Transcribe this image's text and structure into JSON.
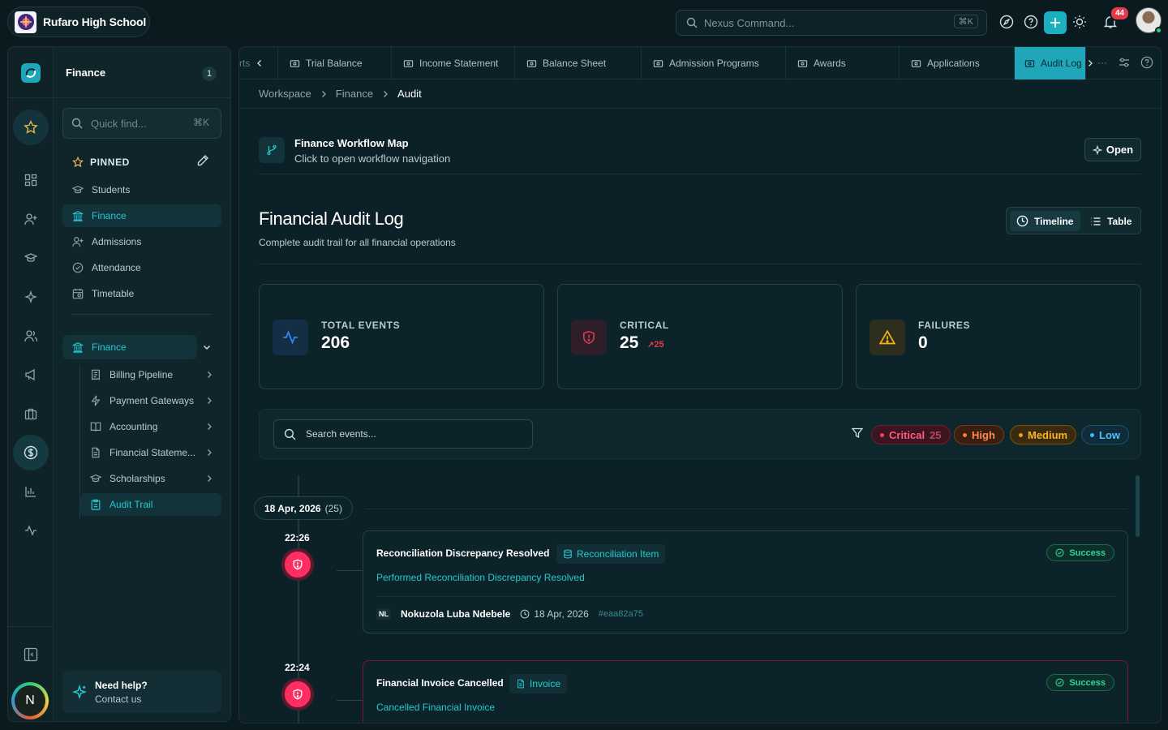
{
  "app": {
    "school_name": "Rufaro High School"
  },
  "topbar": {
    "command_placeholder": "Nexus Command...",
    "command_shortcut": "⌘K",
    "notification_count": "44"
  },
  "sidebar": {
    "title": "Finance",
    "count": "1",
    "quick_find_placeholder": "Quick find...",
    "quick_find_shortcut": "⌘K",
    "pinned_label": "PINNED",
    "pinned_items": [
      {
        "label": "Students",
        "icon": "graduation-cap-icon"
      },
      {
        "label": "Finance",
        "icon": "bank-icon",
        "active": true
      },
      {
        "label": "Admissions",
        "icon": "user-plus-icon"
      },
      {
        "label": "Attendance",
        "icon": "check-circle-icon"
      },
      {
        "label": "Timetable",
        "icon": "calendar-icon"
      }
    ],
    "group_label": "Finance",
    "sub_items": [
      {
        "label": "Billing Pipeline",
        "icon": "receipt-icon"
      },
      {
        "label": "Payment Gateways",
        "icon": "zap-icon"
      },
      {
        "label": "Accounting",
        "icon": "book-icon"
      },
      {
        "label": "Financial Stateme...",
        "icon": "file-text-icon"
      },
      {
        "label": "Scholarships",
        "icon": "graduation-cap-icon"
      },
      {
        "label": "Audit Trail",
        "icon": "clipboard-icon",
        "active": true
      }
    ],
    "help_title": "Need help?",
    "help_sub": "Contact us",
    "user_initial": "N"
  },
  "tabs": {
    "overflow_prefix": "rts",
    "items": [
      {
        "label": "Trial Balance"
      },
      {
        "label": "Income Statement"
      },
      {
        "label": "Balance Sheet"
      },
      {
        "label": "Admission Programs"
      },
      {
        "label": "Awards"
      },
      {
        "label": "Applications"
      },
      {
        "label": "Audit Log",
        "active": true
      }
    ]
  },
  "breadcrumb": [
    "Workspace",
    "Finance",
    "Audit"
  ],
  "workflow": {
    "title": "Finance Workflow Map",
    "subtitle": "Click to open workflow navigation",
    "open_label": "Open"
  },
  "page": {
    "title": "Financial Audit Log",
    "subtitle": "Complete audit trail for all financial operations"
  },
  "view_toggle": {
    "timeline": "Timeline",
    "table": "Table",
    "active": "timeline"
  },
  "stats": [
    {
      "label": "TOTAL EVENTS",
      "value": "206",
      "icon": "activity-icon",
      "color": "#3b82f6"
    },
    {
      "label": "CRITICAL",
      "value": "25",
      "trend": "25",
      "icon": "shield-alert-icon",
      "color": "#e23a4b"
    },
    {
      "label": "FAILURES",
      "value": "0",
      "icon": "warning-triangle-icon",
      "color": "#f5b50b"
    }
  ],
  "filters": {
    "search_placeholder": "Search events...",
    "chips": [
      {
        "label": "Critical",
        "count": "25",
        "color": "#ff3b5c"
      },
      {
        "label": "High",
        "color": "#ff7a2e"
      },
      {
        "label": "Medium",
        "color": "#f59e0b"
      },
      {
        "label": "Low",
        "color": "#38bdf8"
      }
    ]
  },
  "timeline": {
    "date_label": "18 Apr, 2026",
    "date_count": "(25)",
    "events": [
      {
        "time": "22:26",
        "title": "Reconciliation Discrepancy Resolved",
        "entity": "Reconciliation Item",
        "description": "Performed Reconciliation Discrepancy Resolved",
        "status": "Success",
        "user_initials": "NL",
        "user": "Nokuzola Luba Ndebele",
        "date": "18 Apr, 2026",
        "hash": "#eaa82a75"
      },
      {
        "time": "22:24",
        "title": "Financial Invoice Cancelled",
        "entity": "Invoice",
        "description": "Cancelled Financial Invoice",
        "status": "Success"
      }
    ]
  },
  "colors": {
    "accent": "#27c7d4",
    "critical": "#ff2e62",
    "success": "#2fd49a",
    "background": "#0b1a1f"
  }
}
